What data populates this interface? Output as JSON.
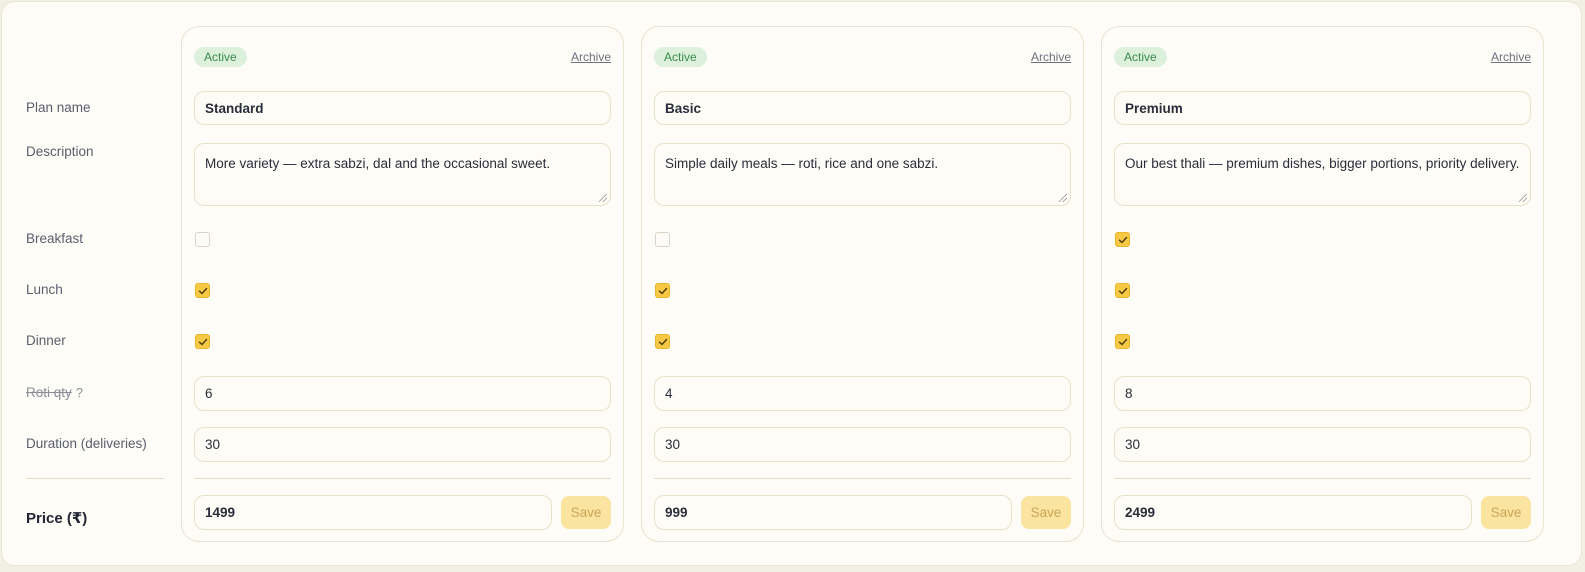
{
  "row_labels": {
    "plan_name": "Plan name",
    "description": "Description",
    "breakfast": "Breakfast",
    "lunch": "Lunch",
    "dinner": "Dinner",
    "roti_qty": "Roti qty",
    "roti_help": "?",
    "duration": "Duration (deliveries)",
    "price": "Price (₹)"
  },
  "colors": {
    "active_badge_bg": "#dcf0dc",
    "active_badge_text": "#3d8b4f",
    "checkbox_checked": "#f7c843",
    "save_button_bg": "#fbe3a0"
  },
  "plans": [
    {
      "status": "Active",
      "archive_label": "Archive",
      "name": "Standard",
      "description": "More variety — extra sabzi, dal and the occasional sweet.",
      "breakfast": false,
      "lunch": true,
      "dinner": true,
      "roti_qty": "6",
      "duration": "30",
      "price": "1499",
      "save_label": "Save"
    },
    {
      "status": "Active",
      "archive_label": "Archive",
      "name": "Basic",
      "description": "Simple daily meals — roti, rice and one sabzi.",
      "breakfast": false,
      "lunch": true,
      "dinner": true,
      "roti_qty": "4",
      "duration": "30",
      "price": "999",
      "save_label": "Save"
    },
    {
      "status": "Active",
      "archive_label": "Archive",
      "name": "Premium",
      "description": "Our best thali — premium dishes, bigger portions, priority delivery.",
      "breakfast": true,
      "lunch": true,
      "dinner": true,
      "roti_qty": "8",
      "duration": "30",
      "price": "2499",
      "save_label": "Save"
    }
  ]
}
